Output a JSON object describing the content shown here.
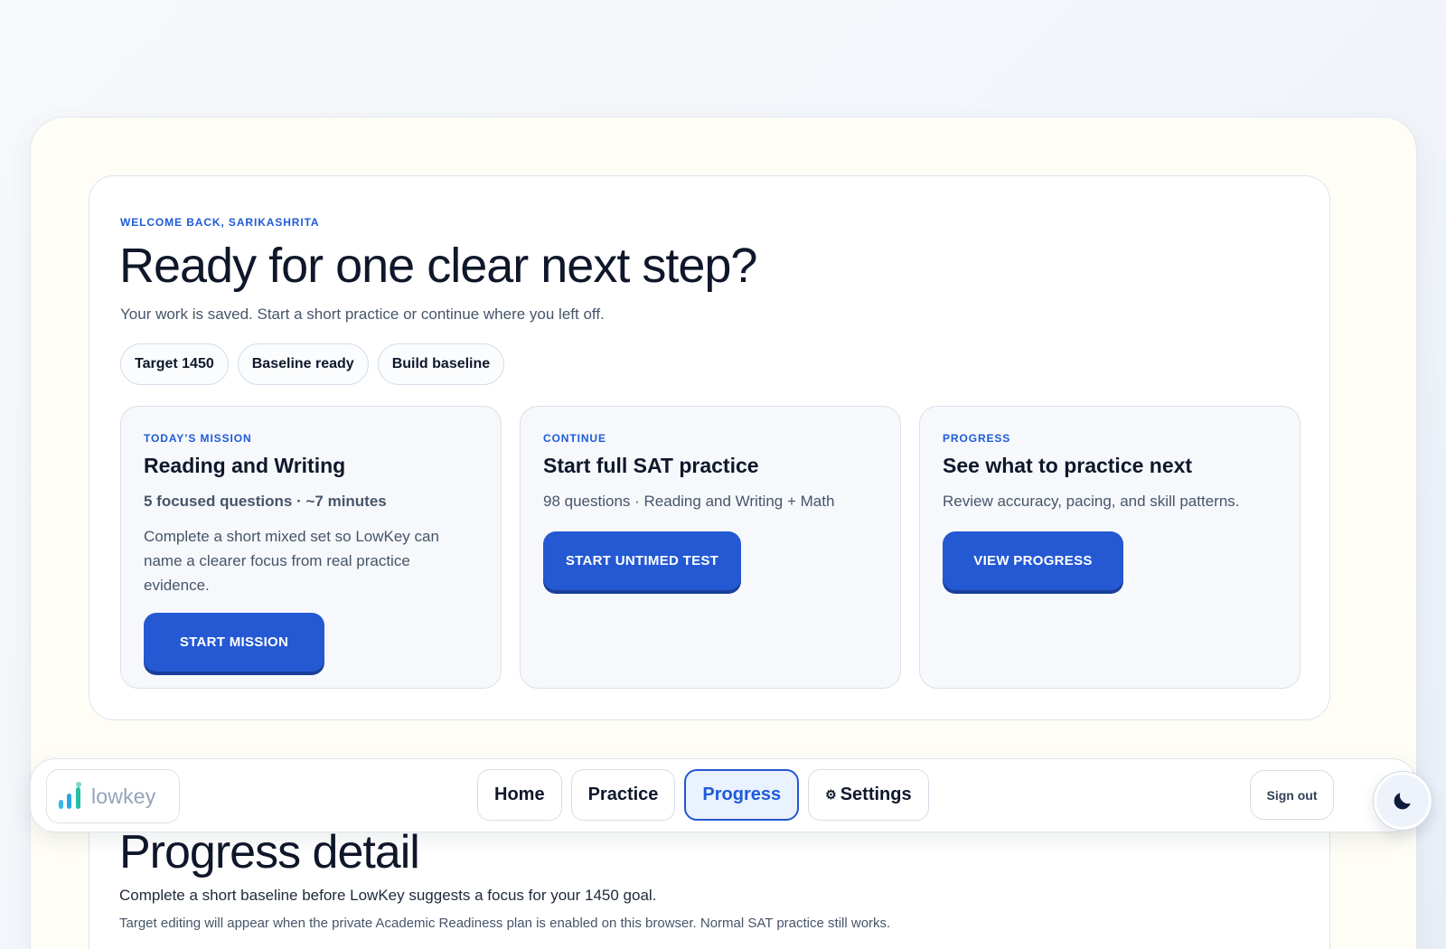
{
  "hero": {
    "eyebrow": "WELCOME BACK, SARIKASHRITA",
    "title": "Ready for one clear next step?",
    "subtitle": "Your work is saved. Start a short practice or continue where you left off.",
    "chips": [
      "Target 1450",
      "Baseline ready",
      "Build baseline"
    ]
  },
  "cards": [
    {
      "eyebrow": "TODAY’S MISSION",
      "title": "Reading and Writing",
      "meta": "5 focused questions · ~7 minutes",
      "description": "Complete a short mixed set so LowKey can name a clearer focus from real practice evidence.",
      "button": "START MISSION"
    },
    {
      "eyebrow": "CONTINUE",
      "title": "Start full SAT practice",
      "meta": "98 questions · Reading and Writing + Math",
      "button": "START UNTIMED TEST"
    },
    {
      "eyebrow": "PROGRESS",
      "title": "See what to practice next",
      "meta": "Review accuracy, pacing, and skill patterns.",
      "button": "VIEW PROGRESS"
    }
  ],
  "progress": {
    "title": "Progress detail",
    "line1": "Complete a short baseline before LowKey suggests a focus for your 1450 goal.",
    "line2": "Target editing will appear when the private Academic Readiness plan is enabled on this browser. Normal SAT practice still works."
  },
  "nav": {
    "logo_text": "lowkey",
    "tabs": [
      "Home",
      "Practice",
      "Progress",
      "Settings"
    ],
    "active_tab": "Progress",
    "settings_icon": "gear-icon",
    "signout": "Sign out",
    "theme_icon": "moon-icon"
  },
  "colors": {
    "accent": "#2459d3",
    "eyebrow": "#1d5bd8",
    "shell_bg": "#fefdf6"
  }
}
